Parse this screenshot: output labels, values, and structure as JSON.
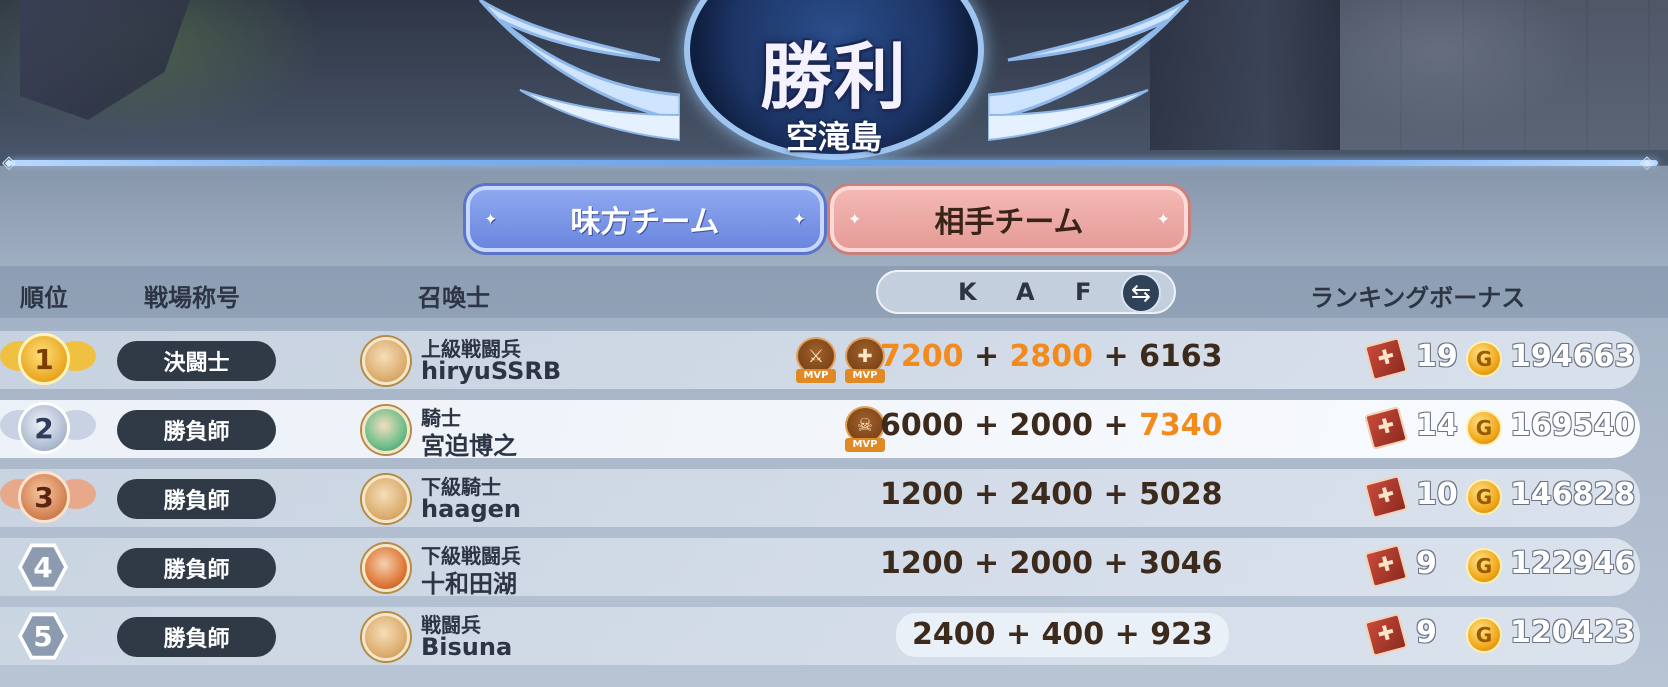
{
  "result_title": "勝利",
  "map_name": "空滝島",
  "tabs": [
    {
      "label": "味方チーム",
      "active": true
    },
    {
      "label": "相手チーム",
      "active": false
    }
  ],
  "headers": {
    "rank": "順位",
    "battle_title": "戦場称号",
    "summoner": "召喚士",
    "kaf": [
      "K",
      "A",
      "F"
    ],
    "ranking_bonus": "ランキングボーナス"
  },
  "icons": {
    "swap": "swap-icon",
    "bonus": "bonus-ticket-icon",
    "coin": "gold-coin-icon",
    "mvp_kill": "mvp-kill-icon",
    "mvp_assist": "mvp-assist-icon",
    "mvp_flag": "mvp-skull-icon"
  },
  "colors": {
    "highlight": "#f28a1c",
    "ally_tab": "#7a94e4",
    "enemy_tab": "#eaa6a1"
  },
  "mvp_label": "MVP",
  "players": [
    {
      "rank": "1",
      "title": "決闘士",
      "class": "上級戦闘兵",
      "name": "hiryuSSRB",
      "k": "7200",
      "a": "2800",
      "f": "6163",
      "bonus": "19",
      "coins": "194663"
    },
    {
      "rank": "2",
      "title": "勝負師",
      "class": "騎士",
      "name": "宮迫博之",
      "k": "6000",
      "a": "2000",
      "f": "7340",
      "bonus": "14",
      "coins": "169540"
    },
    {
      "rank": "3",
      "title": "勝負師",
      "class": "下級騎士",
      "name": "haagen",
      "k": "1200",
      "a": "2400",
      "f": "5028",
      "bonus": "10",
      "coins": "146828"
    },
    {
      "rank": "4",
      "title": "勝負師",
      "class": "下級戦闘兵",
      "name": "十和田湖",
      "k": "1200",
      "a": "2000",
      "f": "3046",
      "bonus": "9",
      "coins": "122946"
    },
    {
      "rank": "5",
      "title": "勝負師",
      "class": "戦闘兵",
      "name": "Bisuna",
      "k": "2400",
      "a": "400",
      "f": "923",
      "bonus": "9",
      "coins": "120423"
    }
  ]
}
